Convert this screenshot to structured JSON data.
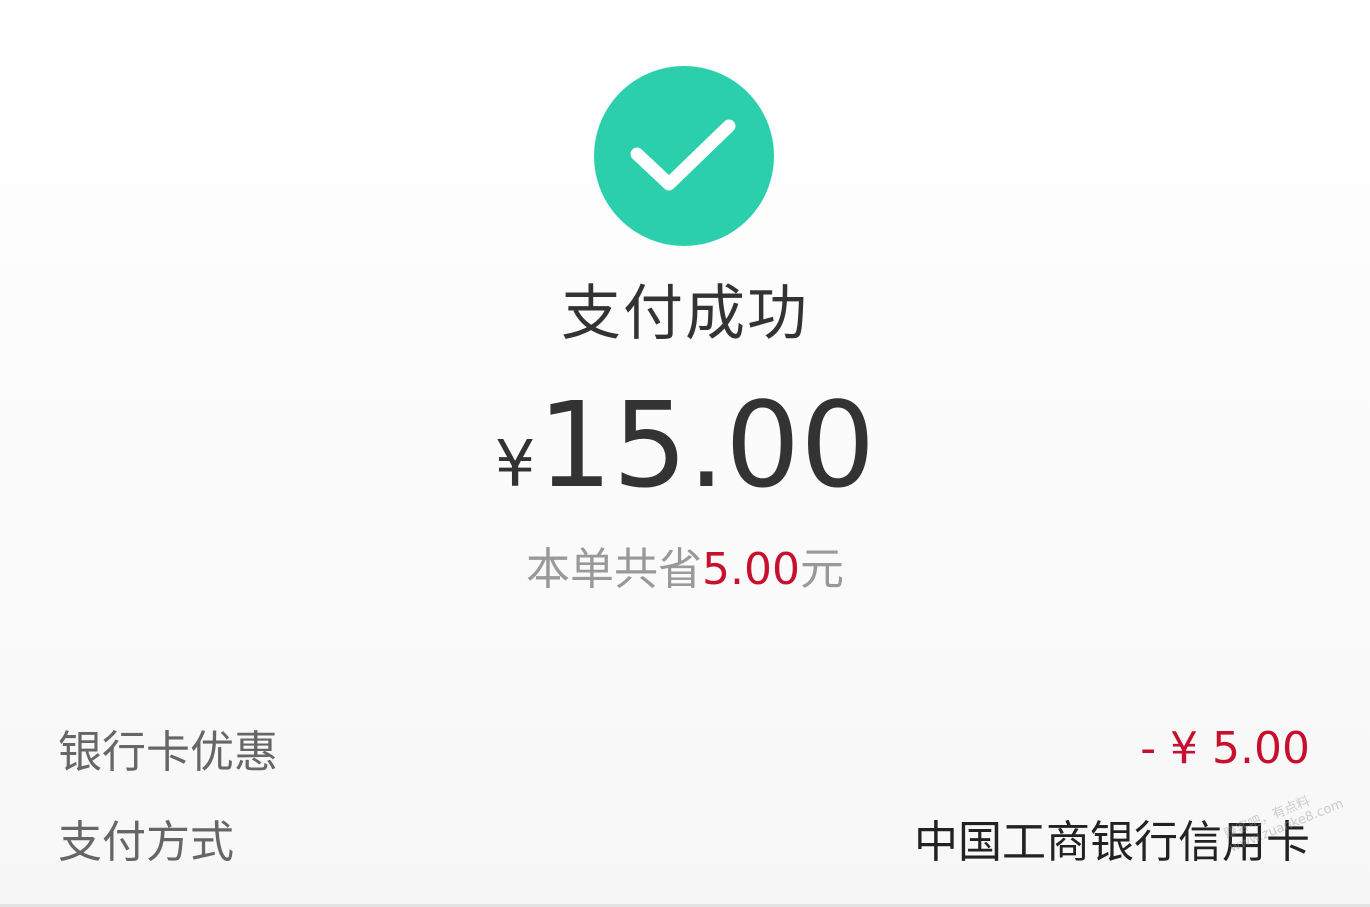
{
  "theme": {
    "success_color": "#2ccfac",
    "highlight_color": "#c8102e"
  },
  "icons": {
    "status": "checkmark-circle-icon"
  },
  "status": {
    "title": "支付成功"
  },
  "payment": {
    "currency_symbol": "¥",
    "amount": "15.00"
  },
  "savings": {
    "prefix": "本单共省",
    "amount": "5.00",
    "suffix": "元"
  },
  "details": {
    "discount": {
      "label": "银行卡优惠",
      "value": "- ¥ 5.00"
    },
    "method": {
      "label": "支付方式",
      "value": "中国工商银行信用卡"
    }
  },
  "watermark": {
    "line1": "赚客吧，有点料",
    "line2": "www.zuanke8.com"
  }
}
